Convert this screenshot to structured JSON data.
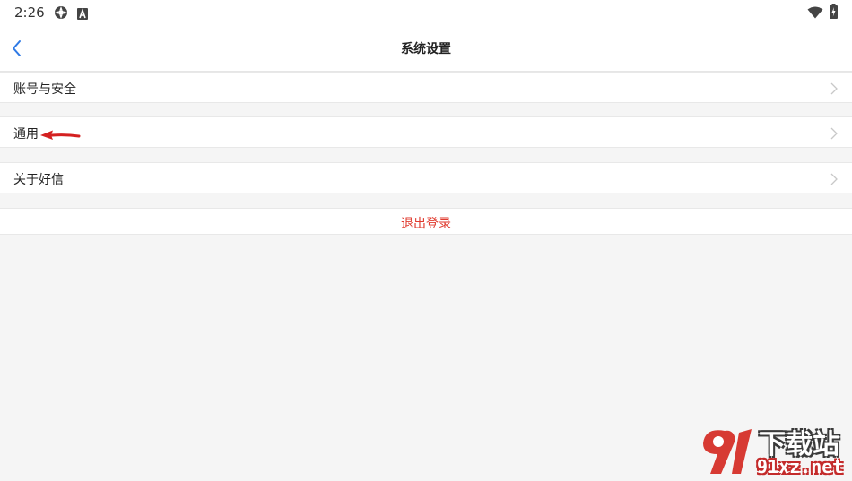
{
  "status_bar": {
    "time": "2:26",
    "icons": [
      "settings-flower-icon",
      "a-badge-icon",
      "wifi-icon",
      "battery-icon"
    ]
  },
  "navbar": {
    "back_icon": "chevron-left-icon",
    "title": "系统设置"
  },
  "settings": {
    "items": [
      {
        "label": "账号与安全"
      },
      {
        "label": "通用"
      },
      {
        "label": "关于好信"
      }
    ],
    "logout_label": "退出登录"
  },
  "annotation": {
    "arrow_color": "#d42020"
  },
  "watermark": {
    "title": "下载站",
    "url": "91xz.net",
    "logo": "91"
  },
  "colors": {
    "accent": "#2f7ae5",
    "logout": "#e03a2e",
    "background": "#f5f5f5",
    "chevron": "#c8c8c8"
  }
}
